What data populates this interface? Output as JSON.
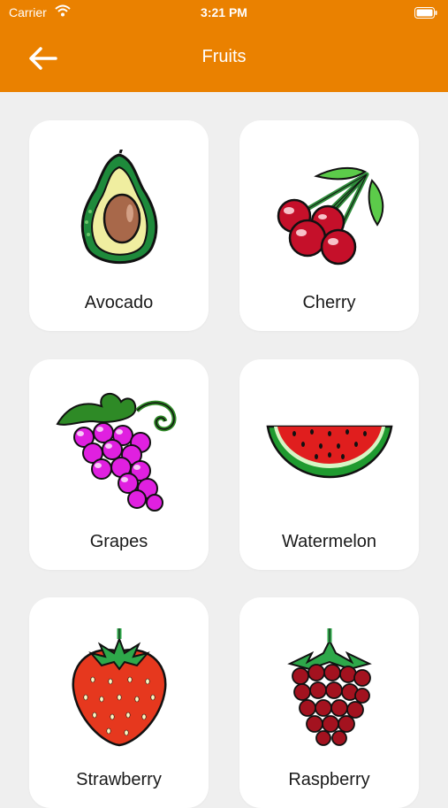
{
  "status_bar": {
    "carrier": "Carrier",
    "time": "3:21 PM"
  },
  "header": {
    "title": "Fruits",
    "back_icon": "arrow-left-icon"
  },
  "colors": {
    "header_bg": "#ea8100",
    "page_bg": "#efefef",
    "card_bg": "#ffffff"
  },
  "fruits": [
    {
      "label": "Avocado",
      "icon": "avocado-icon"
    },
    {
      "label": "Cherry",
      "icon": "cherry-icon"
    },
    {
      "label": "Grapes",
      "icon": "grapes-icon"
    },
    {
      "label": "Watermelon",
      "icon": "watermelon-icon"
    },
    {
      "label": "Strawberry",
      "icon": "strawberry-icon"
    },
    {
      "label": "Raspberry",
      "icon": "raspberry-icon"
    }
  ]
}
